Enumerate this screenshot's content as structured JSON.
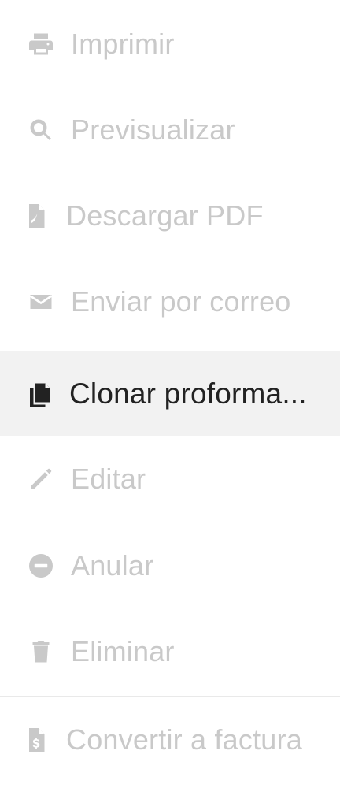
{
  "menu": {
    "items": [
      {
        "label": "Imprimir",
        "icon": "print-icon"
      },
      {
        "label": "Previsualizar",
        "icon": "search-icon"
      },
      {
        "label": "Descargar PDF",
        "icon": "pdf-file-icon"
      },
      {
        "label": "Enviar por correo",
        "icon": "envelope-icon"
      },
      {
        "label": "Clonar proforma...",
        "icon": "copy-icon"
      },
      {
        "label": "Editar",
        "icon": "pencil-icon"
      },
      {
        "label": "Anular",
        "icon": "minus-circle-icon"
      },
      {
        "label": "Eliminar",
        "icon": "trash-icon"
      },
      {
        "label": "Convertir a factura",
        "icon": "invoice-dollar-icon"
      }
    ]
  },
  "colors": {
    "disabled_text": "#c9c9c9",
    "active_text": "#222222",
    "active_background": "#f2f2f2",
    "divider": "#e9e9e9"
  }
}
